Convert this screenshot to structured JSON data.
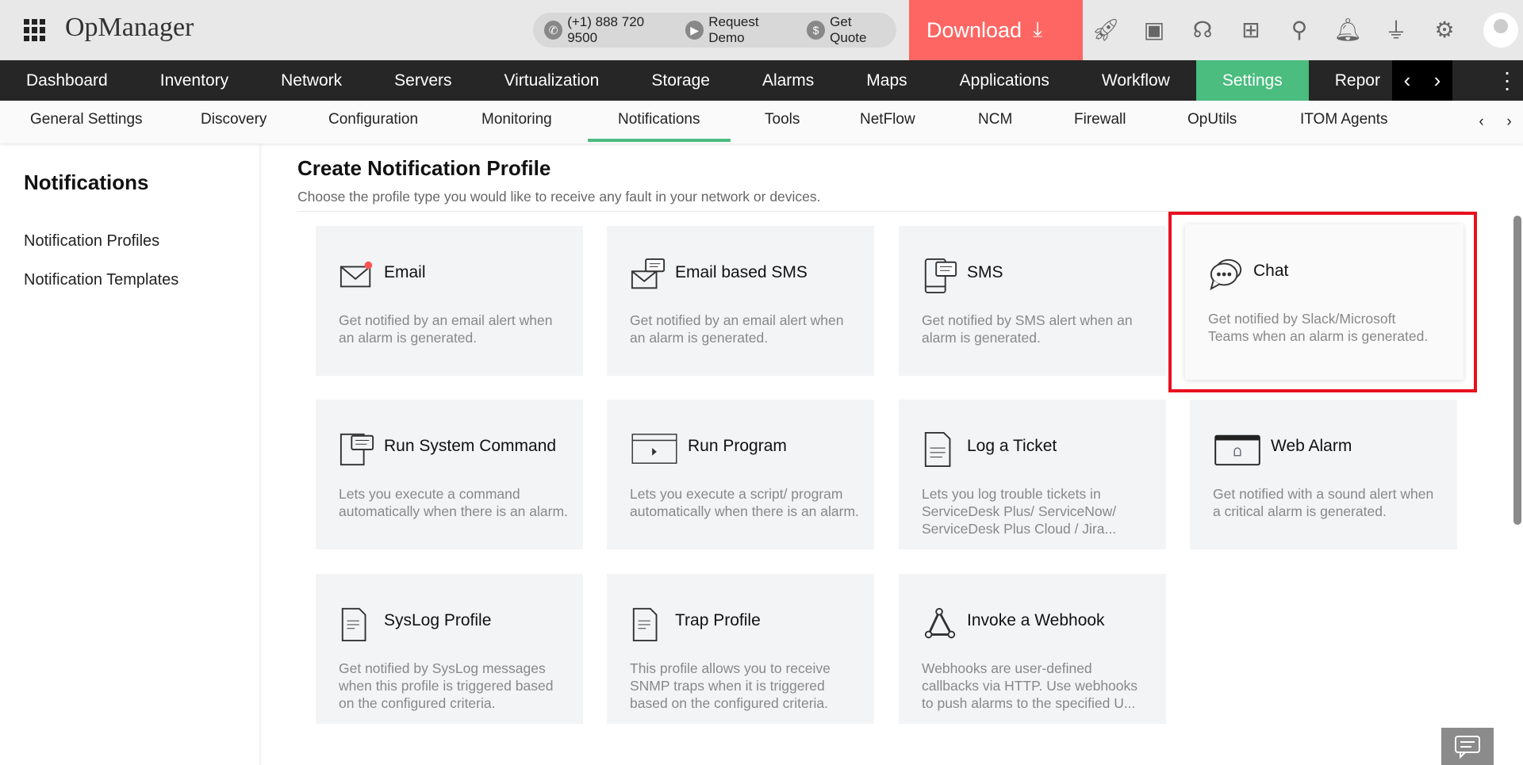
{
  "header": {
    "app_name": "OpManager",
    "phone": "(+1) 888 720 9500",
    "request_demo": "Request Demo",
    "get_quote": "Get Quote",
    "download": "Download"
  },
  "nav": [
    "Dashboard",
    "Inventory",
    "Network",
    "Servers",
    "Virtualization",
    "Storage",
    "Alarms",
    "Maps",
    "Applications",
    "Workflow",
    "Settings",
    "Repor"
  ],
  "subnav": [
    "General Settings",
    "Discovery",
    "Configuration",
    "Monitoring",
    "Notifications",
    "Tools",
    "NetFlow",
    "NCM",
    "Firewall",
    "OpUtils",
    "ITOM Agents"
  ],
  "sidebar": {
    "title": "Notifications",
    "items": [
      "Notification Profiles",
      "Notification Templates"
    ]
  },
  "main": {
    "title": "Create Notification Profile",
    "subtitle": "Choose the profile type you would like to receive any fault in your network or devices.",
    "cards": [
      {
        "title": "Email",
        "desc": "Get notified by an email alert when an alarm is generated.",
        "icon": "email-icon"
      },
      {
        "title": "Email based SMS",
        "desc": "Get notified by an email alert when an alarm is generated.",
        "icon": "email-sms-icon"
      },
      {
        "title": "SMS",
        "desc": "Get notified by SMS alert when an alarm is generated.",
        "icon": "sms-icon"
      },
      {
        "title": "Chat",
        "desc": "Get notified by Slack/Microsoft Teams when an alarm is generated.",
        "icon": "chat-icon"
      },
      {
        "title": "Run System Command",
        "desc": "Lets you execute a command automatically when there is an alarm.",
        "icon": "command-icon"
      },
      {
        "title": "Run Program",
        "desc": "Lets you execute a script/ program automatically when there is an alarm.",
        "icon": "program-icon"
      },
      {
        "title": "Log a Ticket",
        "desc": "Lets you log trouble tickets in ServiceDesk Plus/ ServiceNow/ ServiceDesk Plus Cloud / Jira...",
        "icon": "ticket-icon"
      },
      {
        "title": "Web Alarm",
        "desc": "Get notified with a sound alert when a critical alarm is generated.",
        "icon": "web-alarm-icon"
      },
      {
        "title": "SysLog Profile",
        "desc": "Get notified by SysLog messages when this profile is triggered based on the configured criteria.",
        "icon": "syslog-icon"
      },
      {
        "title": "Trap Profile",
        "desc": "This profile allows you to receive SNMP traps when it is triggered based on the configured criteria.",
        "icon": "trap-icon"
      },
      {
        "title": "Invoke a Webhook",
        "desc": "Webhooks are user-defined callbacks via HTTP. Use webhooks to push alarms to the specified U...",
        "icon": "webhook-icon"
      }
    ]
  },
  "colors": {
    "accent": "#4abd7f",
    "download": "#fe6663",
    "highlight": "#e8101e"
  }
}
